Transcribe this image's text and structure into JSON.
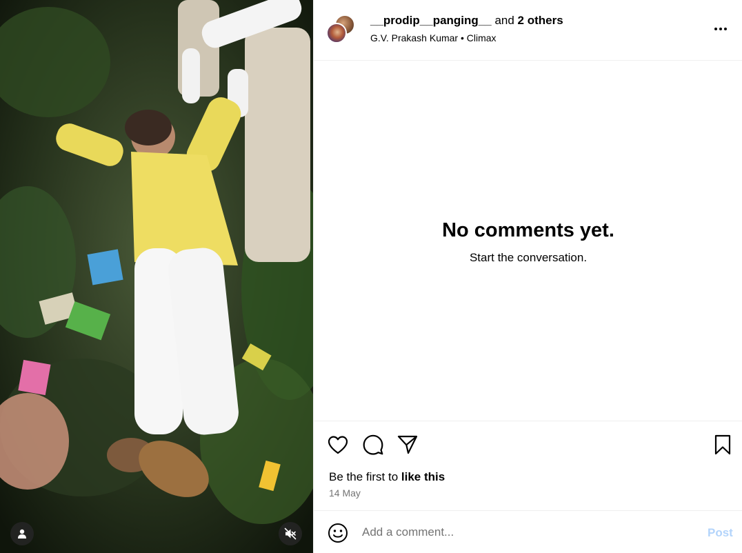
{
  "header": {
    "username": "__prodip__panging__",
    "and_text": "and",
    "others": "2 others",
    "audio": "G.V. Prakash Kumar • Climax"
  },
  "comments": {
    "empty_title": "No comments yet.",
    "empty_subtitle": "Start the conversation."
  },
  "actions": {
    "likes_prefix": "Be the first to",
    "likes_link": "like this",
    "date": "14 May"
  },
  "comment_box": {
    "placeholder": "Add a comment...",
    "post_label": "Post"
  },
  "media": {
    "icons": [
      "tag-user-icon",
      "muted-speaker-icon"
    ]
  },
  "colors": {
    "post_disabled": "#b3d4fb",
    "muted_text": "#737373",
    "divider": "#efefef"
  }
}
